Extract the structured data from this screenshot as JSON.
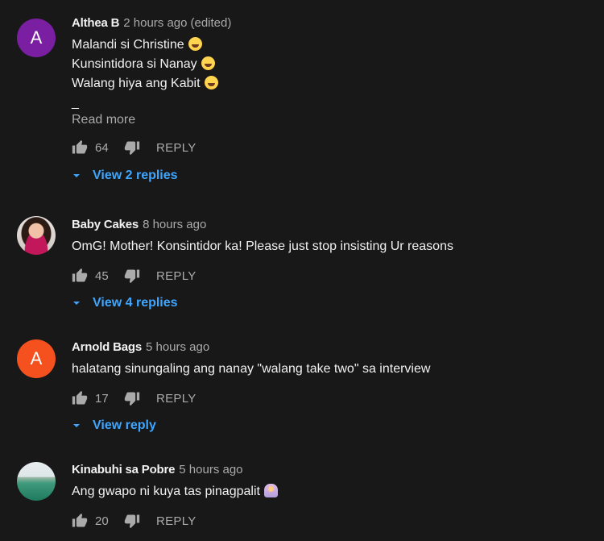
{
  "comments": [
    {
      "avatar_letter": "A",
      "author": "Althea B",
      "time": "2 hours ago",
      "edited": "(edited)",
      "lines": [
        "Malandi si Christine",
        "Kunsintidora si Nanay",
        "Walang hiya ang Kabit"
      ],
      "ellipsis": "_",
      "read_more": "Read more",
      "likes": "64",
      "reply_label": "REPLY",
      "view_replies": "View 2 replies"
    },
    {
      "author": "Baby Cakes",
      "time": "8 hours ago",
      "lines": [
        "OmG! Mother! Konsintidor ka! Please just stop insisting Ur reasons"
      ],
      "likes": "45",
      "reply_label": "REPLY",
      "view_replies": "View 4 replies"
    },
    {
      "avatar_letter": "A",
      "author": "Arnold Bags",
      "time": "5 hours ago",
      "lines": [
        "halatang sinungaling ang nanay \"walang take two\" sa interview"
      ],
      "likes": "17",
      "reply_label": "REPLY",
      "view_replies": "View reply"
    },
    {
      "author": "Kinabuhi sa Pobre",
      "time": "5 hours ago",
      "lines": [
        "Ang gwapo ni kuya tas pinagpalit"
      ],
      "likes": "20",
      "reply_label": "REPLY"
    }
  ],
  "icons": {
    "like": "thumbs-up-icon",
    "dislike": "thumbs-down-icon",
    "expand": "chevron-down-icon",
    "emoji_laugh": "face-with-tears-of-joy",
    "emoji_person": "person-facepalming"
  },
  "colors": {
    "background": "#181818",
    "link_blue": "#3ea6ff",
    "secondary_text": "#aaaaaa",
    "primary_text": "#f1f1f1"
  }
}
